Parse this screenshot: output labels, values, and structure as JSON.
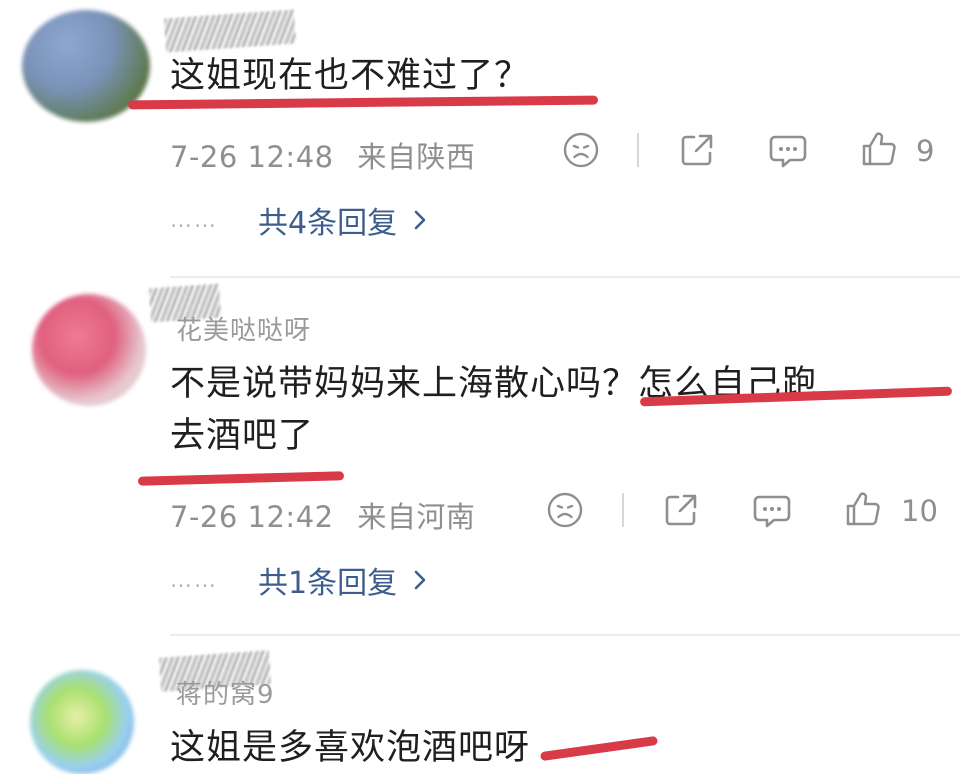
{
  "comments": [
    {
      "username": "",
      "text_lines": [
        "这姐现在也不难过了？"
      ],
      "time": "7-26 12:48",
      "location": "来自陕西",
      "likes": "9",
      "replies_label": "共4条回复",
      "avatar_colors": [
        "#7a92b8",
        "#6f8a5a"
      ]
    },
    {
      "username": "花美哒哒呀",
      "text_lines": [
        "不是说带妈妈来上海散心吗？怎么自己跑",
        "去酒吧了"
      ],
      "time": "7-26 12:42",
      "location": "来自河南",
      "likes": "10",
      "replies_label": "共1条回复",
      "avatar_colors": [
        "#e0607e",
        "#d8d8d8"
      ]
    },
    {
      "username": "蒋的窝9",
      "text_lines": [
        "这姐是多喜欢泡酒吧呀"
      ],
      "avatar_colors": [
        "#5a8fd8",
        "#a8e070"
      ]
    }
  ],
  "ui": {
    "replies_dots": "……",
    "accent": "#3d5e8c",
    "underline_color": "#d83a48",
    "icons": [
      "sad-face-icon",
      "share-icon",
      "comment-icon",
      "thumbs-up-icon",
      "chevron-right-icon"
    ]
  }
}
